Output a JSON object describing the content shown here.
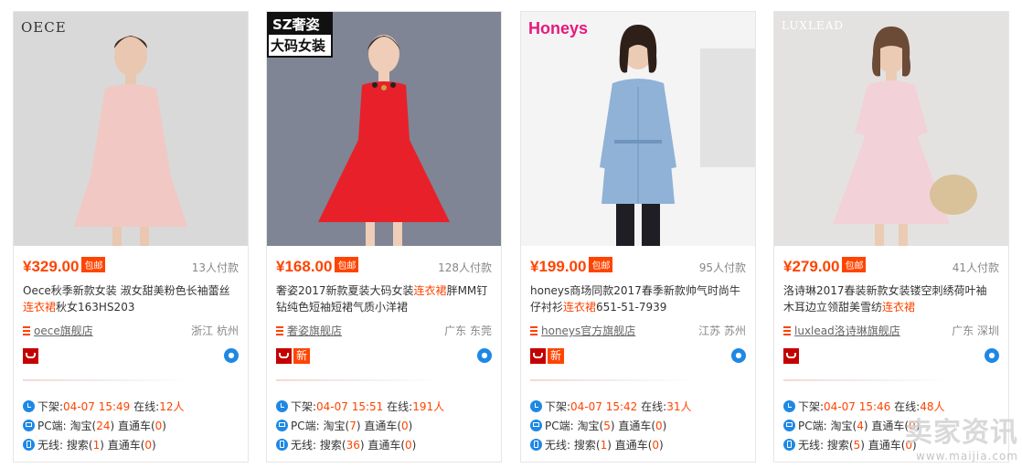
{
  "products": [
    {
      "brand": "OECE",
      "price": "¥329.00",
      "baoyou": "包邮",
      "paid": "13人付款",
      "title_before": "Oece秋季新款女装 淑女甜美粉色长袖蕾丝",
      "title_keyword": "连衣裙",
      "title_after": "秋女163HS203",
      "shop": "oece旗舰店",
      "location": "浙江 杭州",
      "new_badge": "",
      "blur_bg": "#d5d5d5",
      "offline": {
        "label": "下架:",
        "time": "04-07 15:49",
        "online_label": "在线:",
        "online": "12人"
      },
      "pc": {
        "label": "PC端:",
        "taobao_label": "淘宝(",
        "taobao": "24",
        "ztc_label": ") 直通车(",
        "ztc": "0",
        "end": ")"
      },
      "wireless": {
        "label": "无线:",
        "search_label": "搜索(",
        "search": "1",
        "ztc_label": ") 直通车(",
        "ztc": "0",
        "end": ")"
      }
    },
    {
      "brand_top": "SZ奢姿",
      "brand_bottom": "大码女装",
      "price": "¥168.00",
      "baoyou": "包邮",
      "paid": "128人付款",
      "title_before": "奢姿2017新款夏装大码女装",
      "title_keyword": "连衣裙",
      "title_after": "胖MM钉钻纯色短袖短裙气质小洋裙",
      "shop": "奢姿旗舰店",
      "location": "广东 东莞",
      "new_badge": "新",
      "offline": {
        "label": "下架:",
        "time": "04-07 15:51",
        "online_label": "在线:",
        "online": "191人"
      },
      "pc": {
        "label": "PC端:",
        "taobao_label": "淘宝(",
        "taobao": "7",
        "ztc_label": ") 直通车(",
        "ztc": "0",
        "end": ")"
      },
      "wireless": {
        "label": "无线:",
        "search_label": "搜索(",
        "search": "36",
        "ztc_label": ") 直通车(",
        "ztc": "0",
        "end": ")"
      }
    },
    {
      "brand": "Honeys",
      "price": "¥199.00",
      "baoyou": "包邮",
      "paid": "95人付款",
      "title_before": "honeys商场同款2017春季新款帅气时尚牛仔衬衫",
      "title_keyword": "连衣裙",
      "title_after": "651-51-7939",
      "shop": "honeys官方旗舰店",
      "location": "江苏 苏州",
      "new_badge": "新",
      "offline": {
        "label": "下架:",
        "time": "04-07 15:42",
        "online_label": "在线:",
        "online": "31人"
      },
      "pc": {
        "label": "PC端:",
        "taobao_label": "淘宝(",
        "taobao": "5",
        "ztc_label": ") 直通车(",
        "ztc": "0",
        "end": ")"
      },
      "wireless": {
        "label": "无线:",
        "search_label": "搜索(",
        "search": "1",
        "ztc_label": ") 直通车(",
        "ztc": "0",
        "end": ")"
      }
    },
    {
      "brand": "LUXLEAD",
      "price": "¥279.00",
      "baoyou": "包邮",
      "paid": "41人付款",
      "title_before": "洛诗琳2017春装新款女装镂空刺绣荷叶袖 木耳边立领甜美雪纺",
      "title_keyword": "连衣裙",
      "title_after": "",
      "shop": "luxlead洛诗琳旗舰店",
      "location": "广东 深圳",
      "new_badge": "",
      "offline": {
        "label": "下架:",
        "time": "04-07 15:46",
        "online_label": "在线:",
        "online": "48人"
      },
      "pc": {
        "label": "PC端:",
        "taobao_label": "淘宝(",
        "taobao": "4",
        "ztc_label": ") 直通车(",
        "ztc": "0",
        "end": ")"
      },
      "wireless": {
        "label": "无线:",
        "search_label": "搜索(",
        "search": "5",
        "ztc_label": ") 直通车(",
        "ztc": "0",
        "end": ")"
      }
    }
  ],
  "watermark": {
    "main": "卖家资讯",
    "url": "www.maijia.com"
  },
  "colors": {
    "accent": "#ff4400",
    "stat_icon": "#1e88e5",
    "tmall": "#c40000"
  }
}
